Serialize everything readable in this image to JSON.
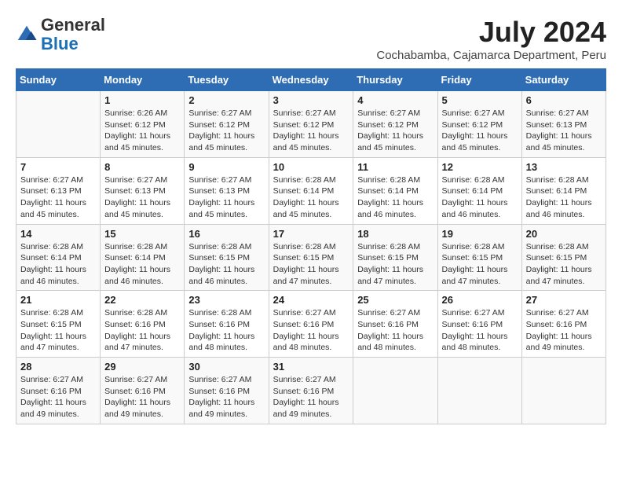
{
  "header": {
    "logo_general": "General",
    "logo_blue": "Blue",
    "month": "July 2024",
    "location": "Cochabamba, Cajamarca Department, Peru"
  },
  "days_of_week": [
    "Sunday",
    "Monday",
    "Tuesday",
    "Wednesday",
    "Thursday",
    "Friday",
    "Saturday"
  ],
  "weeks": [
    [
      {
        "day": "",
        "info": ""
      },
      {
        "day": "1",
        "info": "Sunrise: 6:26 AM\nSunset: 6:12 PM\nDaylight: 11 hours and 45 minutes."
      },
      {
        "day": "2",
        "info": "Sunrise: 6:27 AM\nSunset: 6:12 PM\nDaylight: 11 hours and 45 minutes."
      },
      {
        "day": "3",
        "info": "Sunrise: 6:27 AM\nSunset: 6:12 PM\nDaylight: 11 hours and 45 minutes."
      },
      {
        "day": "4",
        "info": "Sunrise: 6:27 AM\nSunset: 6:12 PM\nDaylight: 11 hours and 45 minutes."
      },
      {
        "day": "5",
        "info": "Sunrise: 6:27 AM\nSunset: 6:12 PM\nDaylight: 11 hours and 45 minutes."
      },
      {
        "day": "6",
        "info": "Sunrise: 6:27 AM\nSunset: 6:13 PM\nDaylight: 11 hours and 45 minutes."
      }
    ],
    [
      {
        "day": "7",
        "info": "Sunrise: 6:27 AM\nSunset: 6:13 PM\nDaylight: 11 hours and 45 minutes."
      },
      {
        "day": "8",
        "info": "Sunrise: 6:27 AM\nSunset: 6:13 PM\nDaylight: 11 hours and 45 minutes."
      },
      {
        "day": "9",
        "info": "Sunrise: 6:27 AM\nSunset: 6:13 PM\nDaylight: 11 hours and 45 minutes."
      },
      {
        "day": "10",
        "info": "Sunrise: 6:28 AM\nSunset: 6:14 PM\nDaylight: 11 hours and 45 minutes."
      },
      {
        "day": "11",
        "info": "Sunrise: 6:28 AM\nSunset: 6:14 PM\nDaylight: 11 hours and 46 minutes."
      },
      {
        "day": "12",
        "info": "Sunrise: 6:28 AM\nSunset: 6:14 PM\nDaylight: 11 hours and 46 minutes."
      },
      {
        "day": "13",
        "info": "Sunrise: 6:28 AM\nSunset: 6:14 PM\nDaylight: 11 hours and 46 minutes."
      }
    ],
    [
      {
        "day": "14",
        "info": "Sunrise: 6:28 AM\nSunset: 6:14 PM\nDaylight: 11 hours and 46 minutes."
      },
      {
        "day": "15",
        "info": "Sunrise: 6:28 AM\nSunset: 6:14 PM\nDaylight: 11 hours and 46 minutes."
      },
      {
        "day": "16",
        "info": "Sunrise: 6:28 AM\nSunset: 6:15 PM\nDaylight: 11 hours and 46 minutes."
      },
      {
        "day": "17",
        "info": "Sunrise: 6:28 AM\nSunset: 6:15 PM\nDaylight: 11 hours and 47 minutes."
      },
      {
        "day": "18",
        "info": "Sunrise: 6:28 AM\nSunset: 6:15 PM\nDaylight: 11 hours and 47 minutes."
      },
      {
        "day": "19",
        "info": "Sunrise: 6:28 AM\nSunset: 6:15 PM\nDaylight: 11 hours and 47 minutes."
      },
      {
        "day": "20",
        "info": "Sunrise: 6:28 AM\nSunset: 6:15 PM\nDaylight: 11 hours and 47 minutes."
      }
    ],
    [
      {
        "day": "21",
        "info": "Sunrise: 6:28 AM\nSunset: 6:15 PM\nDaylight: 11 hours and 47 minutes."
      },
      {
        "day": "22",
        "info": "Sunrise: 6:28 AM\nSunset: 6:16 PM\nDaylight: 11 hours and 47 minutes."
      },
      {
        "day": "23",
        "info": "Sunrise: 6:28 AM\nSunset: 6:16 PM\nDaylight: 11 hours and 48 minutes."
      },
      {
        "day": "24",
        "info": "Sunrise: 6:27 AM\nSunset: 6:16 PM\nDaylight: 11 hours and 48 minutes."
      },
      {
        "day": "25",
        "info": "Sunrise: 6:27 AM\nSunset: 6:16 PM\nDaylight: 11 hours and 48 minutes."
      },
      {
        "day": "26",
        "info": "Sunrise: 6:27 AM\nSunset: 6:16 PM\nDaylight: 11 hours and 48 minutes."
      },
      {
        "day": "27",
        "info": "Sunrise: 6:27 AM\nSunset: 6:16 PM\nDaylight: 11 hours and 49 minutes."
      }
    ],
    [
      {
        "day": "28",
        "info": "Sunrise: 6:27 AM\nSunset: 6:16 PM\nDaylight: 11 hours and 49 minutes."
      },
      {
        "day": "29",
        "info": "Sunrise: 6:27 AM\nSunset: 6:16 PM\nDaylight: 11 hours and 49 minutes."
      },
      {
        "day": "30",
        "info": "Sunrise: 6:27 AM\nSunset: 6:16 PM\nDaylight: 11 hours and 49 minutes."
      },
      {
        "day": "31",
        "info": "Sunrise: 6:27 AM\nSunset: 6:16 PM\nDaylight: 11 hours and 49 minutes."
      },
      {
        "day": "",
        "info": ""
      },
      {
        "day": "",
        "info": ""
      },
      {
        "day": "",
        "info": ""
      }
    ]
  ]
}
